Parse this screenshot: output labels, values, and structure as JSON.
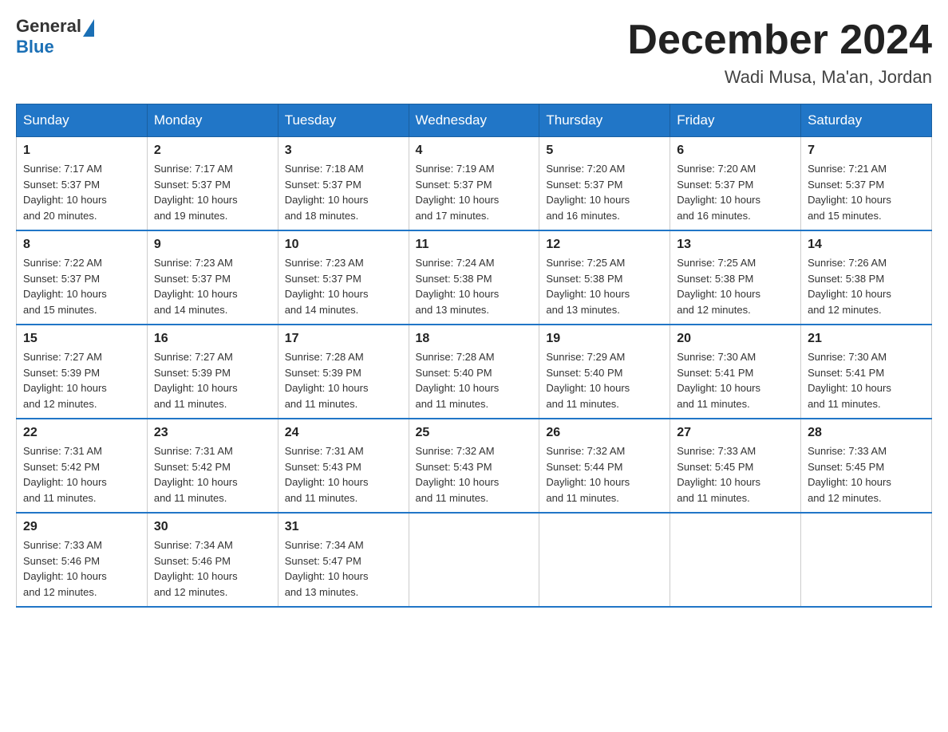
{
  "header": {
    "logo_general": "General",
    "logo_blue": "Blue",
    "title": "December 2024",
    "location": "Wadi Musa, Ma'an, Jordan"
  },
  "days_of_week": [
    "Sunday",
    "Monday",
    "Tuesday",
    "Wednesday",
    "Thursday",
    "Friday",
    "Saturday"
  ],
  "weeks": [
    [
      {
        "day": "1",
        "sunrise": "7:17 AM",
        "sunset": "5:37 PM",
        "daylight": "10 hours and 20 minutes."
      },
      {
        "day": "2",
        "sunrise": "7:17 AM",
        "sunset": "5:37 PM",
        "daylight": "10 hours and 19 minutes."
      },
      {
        "day": "3",
        "sunrise": "7:18 AM",
        "sunset": "5:37 PM",
        "daylight": "10 hours and 18 minutes."
      },
      {
        "day": "4",
        "sunrise": "7:19 AM",
        "sunset": "5:37 PM",
        "daylight": "10 hours and 17 minutes."
      },
      {
        "day": "5",
        "sunrise": "7:20 AM",
        "sunset": "5:37 PM",
        "daylight": "10 hours and 16 minutes."
      },
      {
        "day": "6",
        "sunrise": "7:20 AM",
        "sunset": "5:37 PM",
        "daylight": "10 hours and 16 minutes."
      },
      {
        "day": "7",
        "sunrise": "7:21 AM",
        "sunset": "5:37 PM",
        "daylight": "10 hours and 15 minutes."
      }
    ],
    [
      {
        "day": "8",
        "sunrise": "7:22 AM",
        "sunset": "5:37 PM",
        "daylight": "10 hours and 15 minutes."
      },
      {
        "day": "9",
        "sunrise": "7:23 AM",
        "sunset": "5:37 PM",
        "daylight": "10 hours and 14 minutes."
      },
      {
        "day": "10",
        "sunrise": "7:23 AM",
        "sunset": "5:37 PM",
        "daylight": "10 hours and 14 minutes."
      },
      {
        "day": "11",
        "sunrise": "7:24 AM",
        "sunset": "5:38 PM",
        "daylight": "10 hours and 13 minutes."
      },
      {
        "day": "12",
        "sunrise": "7:25 AM",
        "sunset": "5:38 PM",
        "daylight": "10 hours and 13 minutes."
      },
      {
        "day": "13",
        "sunrise": "7:25 AM",
        "sunset": "5:38 PM",
        "daylight": "10 hours and 12 minutes."
      },
      {
        "day": "14",
        "sunrise": "7:26 AM",
        "sunset": "5:38 PM",
        "daylight": "10 hours and 12 minutes."
      }
    ],
    [
      {
        "day": "15",
        "sunrise": "7:27 AM",
        "sunset": "5:39 PM",
        "daylight": "10 hours and 12 minutes."
      },
      {
        "day": "16",
        "sunrise": "7:27 AM",
        "sunset": "5:39 PM",
        "daylight": "10 hours and 11 minutes."
      },
      {
        "day": "17",
        "sunrise": "7:28 AM",
        "sunset": "5:39 PM",
        "daylight": "10 hours and 11 minutes."
      },
      {
        "day": "18",
        "sunrise": "7:28 AM",
        "sunset": "5:40 PM",
        "daylight": "10 hours and 11 minutes."
      },
      {
        "day": "19",
        "sunrise": "7:29 AM",
        "sunset": "5:40 PM",
        "daylight": "10 hours and 11 minutes."
      },
      {
        "day": "20",
        "sunrise": "7:30 AM",
        "sunset": "5:41 PM",
        "daylight": "10 hours and 11 minutes."
      },
      {
        "day": "21",
        "sunrise": "7:30 AM",
        "sunset": "5:41 PM",
        "daylight": "10 hours and 11 minutes."
      }
    ],
    [
      {
        "day": "22",
        "sunrise": "7:31 AM",
        "sunset": "5:42 PM",
        "daylight": "10 hours and 11 minutes."
      },
      {
        "day": "23",
        "sunrise": "7:31 AM",
        "sunset": "5:42 PM",
        "daylight": "10 hours and 11 minutes."
      },
      {
        "day": "24",
        "sunrise": "7:31 AM",
        "sunset": "5:43 PM",
        "daylight": "10 hours and 11 minutes."
      },
      {
        "day": "25",
        "sunrise": "7:32 AM",
        "sunset": "5:43 PM",
        "daylight": "10 hours and 11 minutes."
      },
      {
        "day": "26",
        "sunrise": "7:32 AM",
        "sunset": "5:44 PM",
        "daylight": "10 hours and 11 minutes."
      },
      {
        "day": "27",
        "sunrise": "7:33 AM",
        "sunset": "5:45 PM",
        "daylight": "10 hours and 11 minutes."
      },
      {
        "day": "28",
        "sunrise": "7:33 AM",
        "sunset": "5:45 PM",
        "daylight": "10 hours and 12 minutes."
      }
    ],
    [
      {
        "day": "29",
        "sunrise": "7:33 AM",
        "sunset": "5:46 PM",
        "daylight": "10 hours and 12 minutes."
      },
      {
        "day": "30",
        "sunrise": "7:34 AM",
        "sunset": "5:46 PM",
        "daylight": "10 hours and 12 minutes."
      },
      {
        "day": "31",
        "sunrise": "7:34 AM",
        "sunset": "5:47 PM",
        "daylight": "10 hours and 13 minutes."
      },
      null,
      null,
      null,
      null
    ]
  ],
  "labels": {
    "sunrise": "Sunrise:",
    "sunset": "Sunset:",
    "daylight": "Daylight:"
  }
}
